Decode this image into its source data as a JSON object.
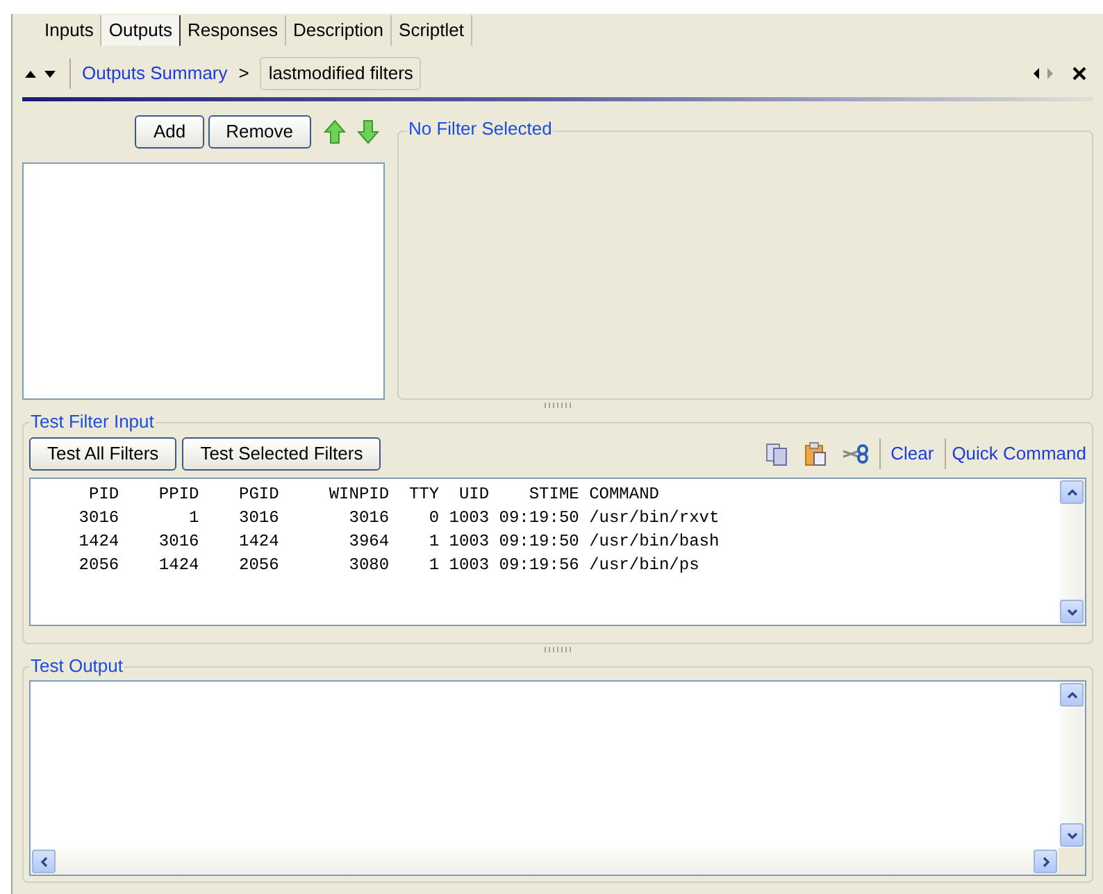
{
  "tabs": [
    {
      "label": "Inputs",
      "selected": false
    },
    {
      "label": "Outputs",
      "selected": true
    },
    {
      "label": "Responses",
      "selected": false
    },
    {
      "label": "Description",
      "selected": false
    },
    {
      "label": "Scriptlet",
      "selected": false
    }
  ],
  "breadcrumb": {
    "link": "Outputs Summary",
    "separator": ">",
    "current": "lastmodified filters"
  },
  "filters": {
    "buttons": [
      "Add",
      "Remove"
    ]
  },
  "filter_detail": {
    "title": "No Filter Selected"
  },
  "test_input": {
    "title": "Test Filter Input",
    "buttons": [
      "Test All Filters",
      "Test Selected Filters"
    ],
    "links": [
      "Clear",
      "Quick Command"
    ],
    "lines": [
      "     PID    PPID    PGID     WINPID  TTY  UID    STIME COMMAND",
      "    3016       1    3016       3016    0 1003 09:19:50 /usr/bin/rxvt",
      "    1424    3016    1424       3964    1 1003 09:19:50 /usr/bin/bash",
      "    2056    1424    2056       3080    1 1003 09:19:56 /usr/bin/ps"
    ]
  },
  "test_output": {
    "title": "Test Output"
  }
}
